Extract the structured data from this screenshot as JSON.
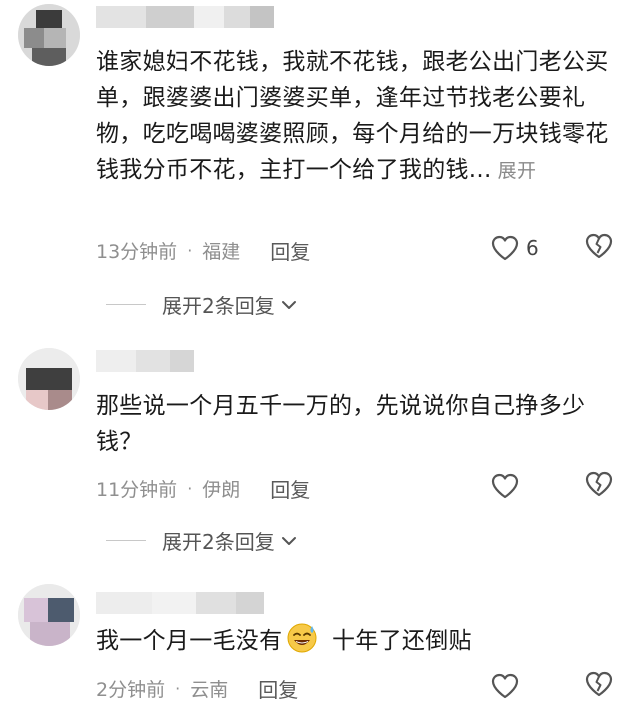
{
  "comments": [
    {
      "text": "谁家媳妇不花钱，我就不花钱，跟老公出门老公买单，跟婆婆出门婆婆买单，逢年过节找老公要礼物，吃吃喝喝婆婆照顾，每个月给的一万块钱零花钱我分币不花，主打一个给了我的钱...",
      "expand_label": "展开",
      "time": "13分钟前",
      "location": "福建",
      "reply_label": "回复",
      "likes": "6",
      "more_replies": "展开2条回复"
    },
    {
      "text": "那些说一个月五千一万的，先说说你自己挣多少钱？",
      "time": "11分钟前",
      "location": "伊朗",
      "reply_label": "回复",
      "likes": "",
      "more_replies": "展开2条回复"
    },
    {
      "text_before": "我一个月一毛没有",
      "text_after": " 十年了还倒贴",
      "emoji": "sweat-smile-emoji",
      "time": "2分钟前",
      "location": "云南",
      "reply_label": "回复",
      "likes": ""
    }
  ],
  "separator": "·",
  "icons": {
    "like": "heart-outline-icon",
    "dislike": "broken-heart-icon",
    "expand": "chevron-down-icon"
  },
  "colors": {
    "text": "#1a1a1a",
    "meta": "#8f8f8f",
    "reply": "#5a5a5a"
  }
}
